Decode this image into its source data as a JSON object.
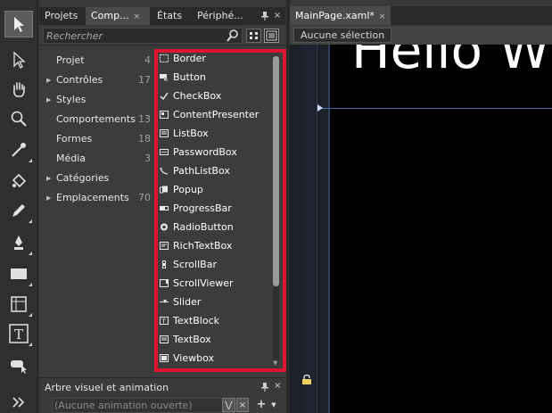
{
  "panel_tabs": [
    {
      "label": "Projets"
    },
    {
      "label": "Comp..."
    },
    {
      "label": "États"
    },
    {
      "label": "Périphé..."
    }
  ],
  "close_glyph": "×",
  "search": {
    "placeholder": "Rechercher"
  },
  "categories": [
    {
      "label": "Projet",
      "count": "4",
      "expandable": false
    },
    {
      "label": "Contrôles",
      "count": "17",
      "expandable": true
    },
    {
      "label": "Styles",
      "count": "",
      "expandable": true
    },
    {
      "label": "Comportements",
      "count": "13",
      "expandable": false
    },
    {
      "label": "Formes",
      "count": "18",
      "expandable": false
    },
    {
      "label": "Média",
      "count": "3",
      "expandable": false
    },
    {
      "label": "Catégories",
      "count": "",
      "expandable": true
    },
    {
      "label": "Emplacements",
      "count": "70",
      "expandable": true
    }
  ],
  "controls": [
    {
      "label": "Border",
      "icon": "border-icon"
    },
    {
      "label": "Button",
      "icon": "button-icon"
    },
    {
      "label": "CheckBox",
      "icon": "checkbox-icon"
    },
    {
      "label": "ContentPresenter",
      "icon": "contentpresenter-icon"
    },
    {
      "label": "ListBox",
      "icon": "listbox-icon"
    },
    {
      "label": "PasswordBox",
      "icon": "passwordbox-icon"
    },
    {
      "label": "PathListBox",
      "icon": "pathlistbox-icon"
    },
    {
      "label": "Popup",
      "icon": "popup-icon"
    },
    {
      "label": "ProgressBar",
      "icon": "progressbar-icon"
    },
    {
      "label": "RadioButton",
      "icon": "radiobutton-icon"
    },
    {
      "label": "RichTextBox",
      "icon": "richtextbox-icon"
    },
    {
      "label": "ScrollBar",
      "icon": "scrollbar-icon"
    },
    {
      "label": "ScrollViewer",
      "icon": "scrollviewer-icon"
    },
    {
      "label": "Slider",
      "icon": "slider-icon"
    },
    {
      "label": "TextBlock",
      "icon": "textblock-icon"
    },
    {
      "label": "TextBox",
      "icon": "textbox-icon"
    },
    {
      "label": "Viewbox",
      "icon": "viewbox-icon"
    }
  ],
  "bottom_panel": {
    "title": "Arbre visuel et animation",
    "animation_select": "(Aucune animation ouverte)",
    "add_label": "+"
  },
  "document": {
    "tab_label": "MainPage.xaml*",
    "breadcrumb": "Aucune sélection",
    "canvas_text": "Hello W"
  },
  "colors": {
    "highlight": "#e0142a",
    "canvas": "#000000",
    "guide": "#4a6da8"
  },
  "tools": [
    "selection-icon",
    "direct-selection-icon",
    "pan-icon",
    "zoom-icon",
    "eyedropper-icon",
    "paint-bucket-icon",
    "brush-icon",
    "pen-icon",
    "rectangle-icon",
    "grid-icon",
    "text-icon",
    "asset-icon",
    "expand-icon"
  ]
}
